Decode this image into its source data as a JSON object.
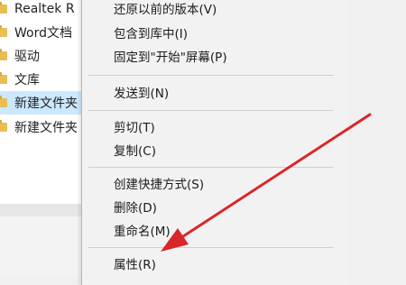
{
  "explorer": {
    "items": [
      {
        "label": "Realtek R"
      },
      {
        "label": "Word文档"
      },
      {
        "label": "驱动"
      },
      {
        "label": "文库"
      },
      {
        "label": "新建文件夹"
      },
      {
        "label": "新建文件夹"
      }
    ]
  },
  "context_menu": {
    "items": [
      {
        "label": "还原以前的版本(V)"
      },
      {
        "label": "包含到库中(I)"
      },
      {
        "label": "固定到\"开始\"屏幕(P)"
      },
      {
        "label": "发送到(N)"
      },
      {
        "label": "剪切(T)"
      },
      {
        "label": "复制(C)"
      },
      {
        "label": "创建快捷方式(S)"
      },
      {
        "label": "删除(D)"
      },
      {
        "label": "重命名(M)"
      },
      {
        "label": "属性(R)"
      }
    ]
  },
  "colors": {
    "selection": "#cce8ff",
    "arrow": "#d8262a",
    "menu_bg": "#f2f2f2",
    "folder": "#e8bd52"
  }
}
